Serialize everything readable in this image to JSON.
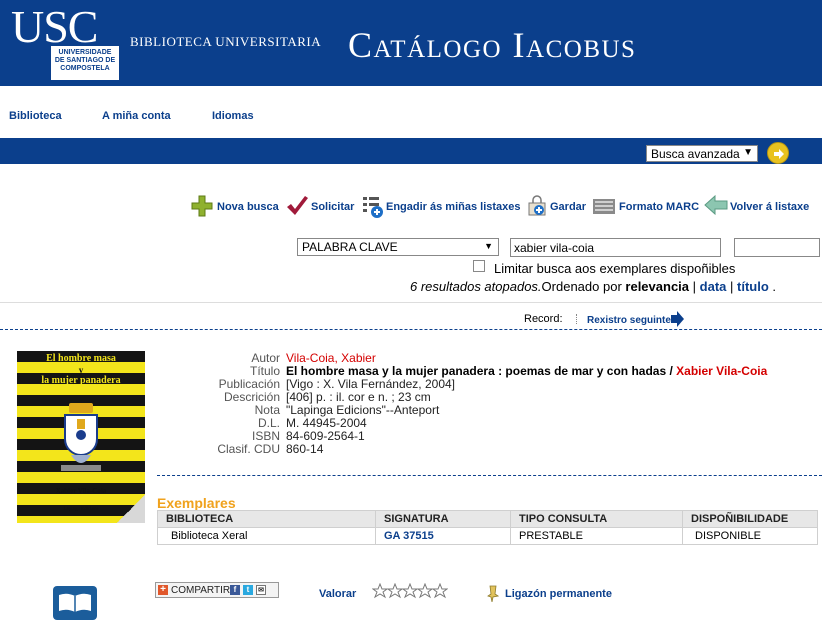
{
  "header": {
    "logo": "USC",
    "logo_sub": "UNIVERSIDADE DE SANTIAGO DE COMPOSTELA",
    "library_name": "BIBLIOTECA UNIVERSITARIA",
    "catalog_title": "Catálogo Iacobus"
  },
  "nav": {
    "items": [
      "Biblioteca",
      "A miña conta",
      "Idiomas"
    ]
  },
  "search_mode": {
    "selected": "Busca avanzada"
  },
  "toolbar": {
    "items": [
      {
        "label": "Nova busca",
        "icon": "plus-icon"
      },
      {
        "label": "Solicitar",
        "icon": "checkmark-icon"
      },
      {
        "label": "Engadir ás miñas listaxes",
        "icon": "list-add-icon"
      },
      {
        "label": "Gardar",
        "icon": "save-bag-icon"
      },
      {
        "label": "Formato MARC",
        "icon": "marc-icon"
      },
      {
        "label": "Volver á listaxe",
        "icon": "back-arrow-icon"
      }
    ]
  },
  "search": {
    "field": "PALABRA CLAVE",
    "query": "xabier vila-coia",
    "secondary": "",
    "limit_label": "Limitar busca aos exemplares dispoñibles",
    "limit_checked": false
  },
  "results": {
    "count_text": "6 resultados atopados.",
    "sort_prefix": "Ordenado por",
    "sort_current": "relevancia",
    "sep1": "|",
    "sort_date": "data",
    "sep2": "|",
    "sort_title": "título",
    "tail": "."
  },
  "record_nav": {
    "label": "Record:",
    "next": "Rexistro seguinte"
  },
  "cover": {
    "title_line1": "El hombre masa",
    "title_line2": "y",
    "title_line3": "la mujer panadera",
    "author": "Xabier Vila-Coia",
    "publisher": "Lapinga Edicions"
  },
  "record": {
    "autor_label": "Autor",
    "autor_value": "Vila-Coia, Xabier",
    "titulo_label": "Título",
    "titulo_value": "El hombre masa y la mujer panadera : poemas de mar y con hadas /",
    "titulo_author": "Xabier Vila-Coia",
    "publicacion_label": "Publicación",
    "publicacion_value": "[Vigo : X. Vila Fernández, 2004]",
    "descricion_label": "Descrición",
    "descricion_value": "[406] p. : il. cor e n. ; 23 cm",
    "nota_label": "Nota",
    "nota_value": "\"Lapinga Edicions\"--Anteport",
    "dl_label": "D.L.",
    "dl_value": "M. 44945-2004",
    "isbn_label": "ISBN",
    "isbn_value": "84-609-2564-1",
    "cdu_label": "Clasif. CDU",
    "cdu_value": "860-14"
  },
  "exemplares": {
    "title": "Exemplares",
    "headers": [
      "BIBLIOTECA",
      "SIGNATURA",
      "TIPO CONSULTA",
      "DISPOÑIBILIDADE"
    ],
    "rows": [
      [
        "Biblioteca Xeral",
        "GA 37515",
        "PRESTABLE",
        "DISPONIBLE"
      ]
    ]
  },
  "footer": {
    "share_label": "COMPARTIR",
    "valorar_label": "Valorar",
    "permalink_label": "Ligazón permanente"
  },
  "colors": {
    "brand_blue": "#0b3f8c",
    "accent_orange": "#f0a21d",
    "author_red": "#d40000",
    "cover_yellow": "#f3e51b"
  }
}
